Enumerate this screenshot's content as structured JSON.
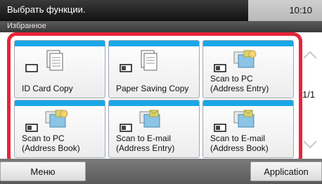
{
  "header": {
    "title": "Выбрать функции.",
    "time": "10:10",
    "subtitle": "Избранное"
  },
  "tiles": [
    {
      "label": "ID Card Copy",
      "icon": "id-card-copy-icon"
    },
    {
      "label": "Paper Saving Copy",
      "icon": "paper-saving-copy-icon"
    },
    {
      "label": "Scan to PC\n(Address Entry)",
      "icon": "scan-to-pc-icon"
    },
    {
      "label": "Scan to PC\n(Address Book)",
      "icon": "scan-to-pc-icon"
    },
    {
      "label": "Scan to E-mail\n(Address Entry)",
      "icon": "scan-to-email-icon"
    },
    {
      "label": "Scan to E-mail\n(Address Book)",
      "icon": "scan-to-email-icon"
    }
  ],
  "pagination": {
    "indicator": "1/1"
  },
  "footer": {
    "left_label": "Меню",
    "right_label": "Application"
  },
  "colors": {
    "accent_red": "#e8233a",
    "tile_blue": "#19a7e8"
  }
}
